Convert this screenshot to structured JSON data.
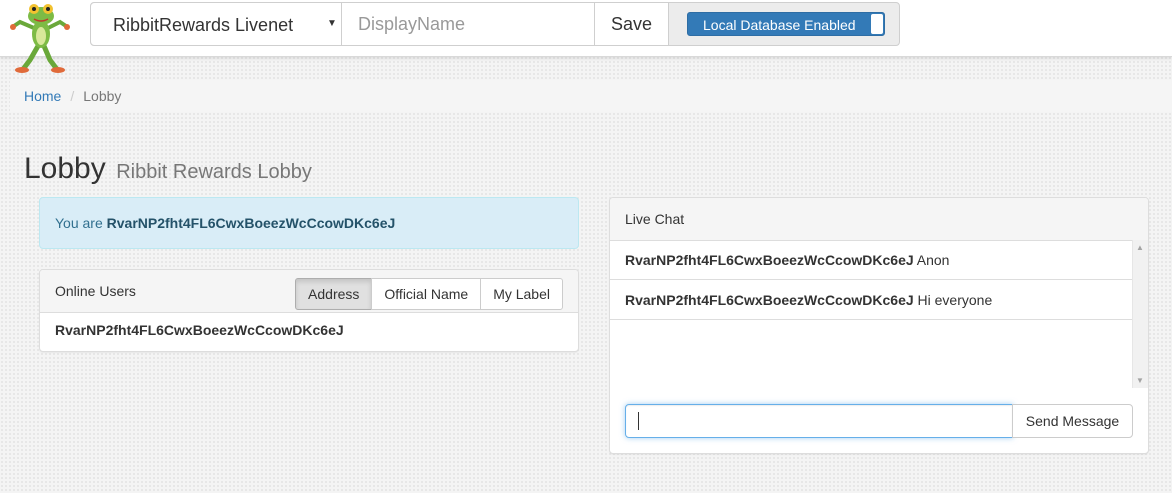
{
  "app": {
    "logo_icon": "frog-mascot-icon"
  },
  "toolbar": {
    "network_selected": "RibbitRewards Livenet",
    "display_name_value": "",
    "display_name_placeholder": "DisplayName",
    "save_label": "Save",
    "db_toggle_label": "Local Database Enabled",
    "db_toggle_on": true
  },
  "breadcrumb": {
    "home": "Home",
    "separator": "/",
    "current": "Lobby"
  },
  "heading": {
    "title": "Lobby",
    "subtitle": "Ribbit Rewards Lobby"
  },
  "identity": {
    "prefix": "You are",
    "address": "RvarNP2fht4FL6CwxBoeezWcCcowDKc6eJ"
  },
  "online_users": {
    "title": "Online Users",
    "view_options": [
      {
        "label": "Address",
        "active": true
      },
      {
        "label": "Official Name",
        "active": false
      },
      {
        "label": "My Label",
        "active": false
      }
    ],
    "users": [
      "RvarNP2fht4FL6CwxBoeezWcCcowDKc6eJ"
    ]
  },
  "live_chat": {
    "title": "Live Chat",
    "messages": [
      {
        "sender": "RvarNP2fht4FL6CwxBoeezWcCcowDKc6eJ",
        "text": "Anon"
      },
      {
        "sender": "RvarNP2fht4FL6CwxBoeezWcCcowDKc6eJ",
        "text": "Hi everyone"
      }
    ],
    "input_value": "",
    "send_label": "Send Message"
  },
  "colors": {
    "primary": "#337ab7",
    "info_bg": "#d9edf7",
    "info_text": "#31708f",
    "focus_border": "#66afe9"
  }
}
